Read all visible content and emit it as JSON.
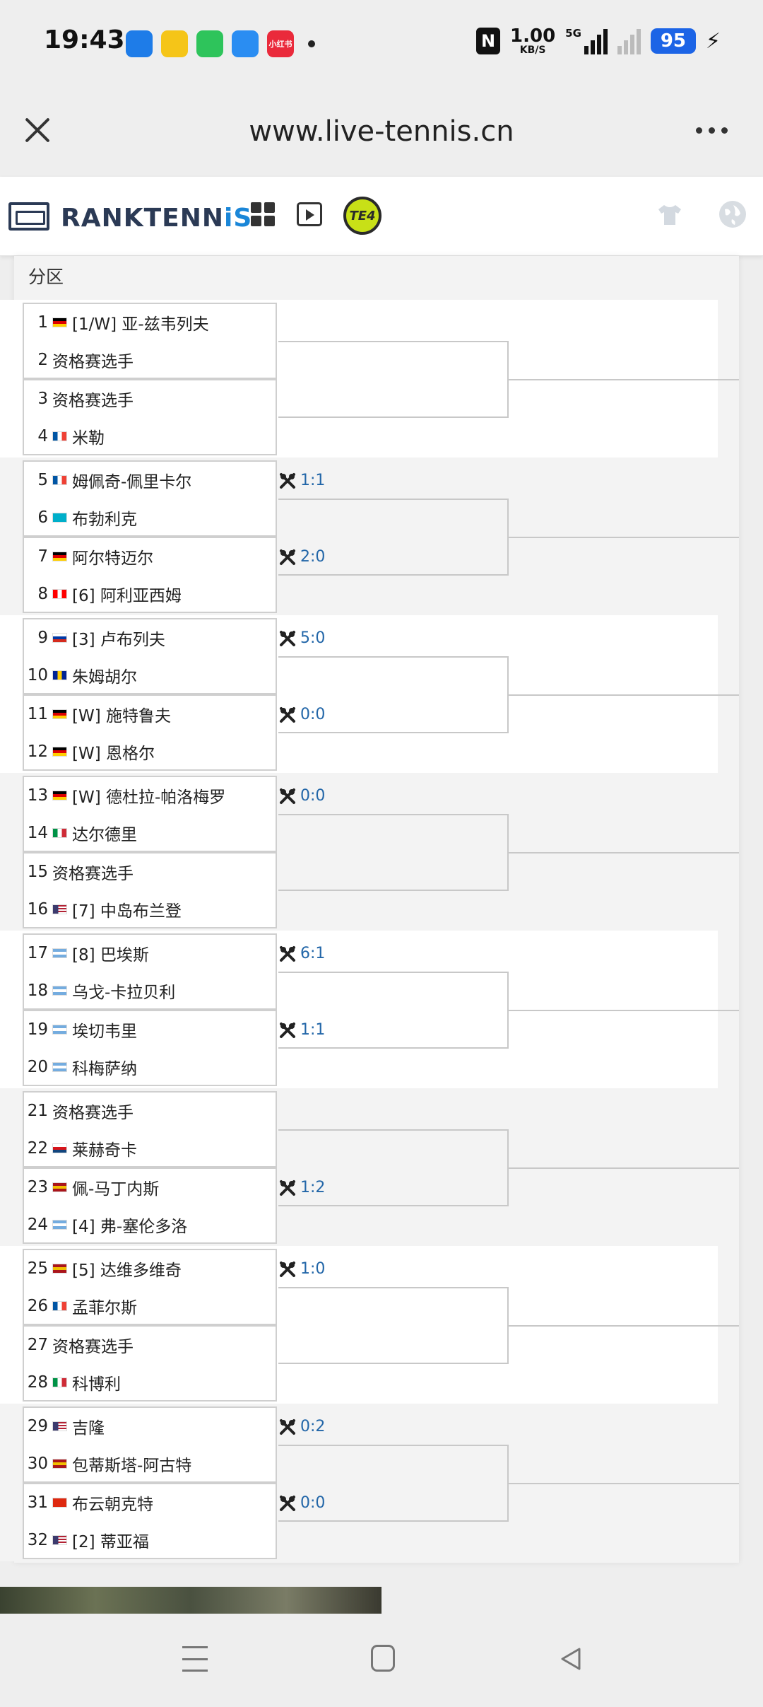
{
  "status_bar": {
    "time": "19:43",
    "apps": [
      {
        "name": "message-app-icon",
        "color": "#1e7ce8",
        "label": ""
      },
      {
        "name": "weibo-app-icon",
        "color": "#f5c518",
        "label": ""
      },
      {
        "name": "green-app-icon",
        "color": "#2ec45b",
        "label": ""
      },
      {
        "name": "feather-app-icon",
        "color": "#2a8df2",
        "label": ""
      },
      {
        "name": "xiaohongshu-app-icon",
        "color": "#ea2a3b",
        "label": "小红书"
      }
    ],
    "nfc": "N",
    "net_speed": "1.00",
    "net_unit": "KB/S",
    "network_type": "5G",
    "battery": "95"
  },
  "browser": {
    "url": "www.live-tennis.cn"
  },
  "site": {
    "logo_primary": "RANKTENN",
    "logo_accent": "iS",
    "badge": "TE4"
  },
  "draw": {
    "section_label": "分区",
    "players": [
      {
        "seed": "1",
        "flag": "de",
        "name": "[1/W] 亚-兹韦列夫"
      },
      {
        "seed": "2",
        "flag": "",
        "name": "资格赛选手"
      },
      {
        "seed": "3",
        "flag": "",
        "name": "资格赛选手"
      },
      {
        "seed": "4",
        "flag": "fr",
        "name": "米勒"
      },
      {
        "seed": "5",
        "flag": "fr",
        "name": "姆佩奇-佩里卡尔"
      },
      {
        "seed": "6",
        "flag": "kz",
        "name": "布勃利克"
      },
      {
        "seed": "7",
        "flag": "de",
        "name": "阿尔特迈尔"
      },
      {
        "seed": "8",
        "flag": "ca",
        "name": "[6] 阿利亚西姆"
      },
      {
        "seed": "9",
        "flag": "ru",
        "name": "[3] 卢布列夫"
      },
      {
        "seed": "10",
        "flag": "ba",
        "name": "朱姆胡尔"
      },
      {
        "seed": "11",
        "flag": "de",
        "name": "[W] 施特鲁夫"
      },
      {
        "seed": "12",
        "flag": "de",
        "name": "[W] 恩格尔"
      },
      {
        "seed": "13",
        "flag": "de",
        "name": "[W] 德杜拉-帕洛梅罗"
      },
      {
        "seed": "14",
        "flag": "it",
        "name": "达尔德里"
      },
      {
        "seed": "15",
        "flag": "",
        "name": "资格赛选手"
      },
      {
        "seed": "16",
        "flag": "us",
        "name": "[7] 中岛布兰登"
      },
      {
        "seed": "17",
        "flag": "ar",
        "name": "[8] 巴埃斯"
      },
      {
        "seed": "18",
        "flag": "ar",
        "name": "乌戈-卡拉贝利"
      },
      {
        "seed": "19",
        "flag": "ar",
        "name": "埃切韦里"
      },
      {
        "seed": "20",
        "flag": "ar",
        "name": "科梅萨纳"
      },
      {
        "seed": "21",
        "flag": "",
        "name": "资格赛选手"
      },
      {
        "seed": "22",
        "flag": "cz",
        "name": "莱赫奇卡"
      },
      {
        "seed": "23",
        "flag": "es",
        "name": "佩-马丁内斯"
      },
      {
        "seed": "24",
        "flag": "ar",
        "name": "[4] 弗-塞伦多洛"
      },
      {
        "seed": "25",
        "flag": "es",
        "name": "[5] 达维多维奇"
      },
      {
        "seed": "26",
        "flag": "fr",
        "name": "孟菲尔斯"
      },
      {
        "seed": "27",
        "flag": "",
        "name": "资格赛选手"
      },
      {
        "seed": "28",
        "flag": "it",
        "name": "科博利"
      },
      {
        "seed": "29",
        "flag": "us",
        "name": "吉隆"
      },
      {
        "seed": "30",
        "flag": "es",
        "name": "包蒂斯塔-阿古特"
      },
      {
        "seed": "31",
        "flag": "cn",
        "name": "布云朝克特"
      },
      {
        "seed": "32",
        "flag": "us",
        "name": "[2] 蒂亚福"
      }
    ],
    "h2h": [
      {
        "match": 2,
        "label": "1:1"
      },
      {
        "match": 3,
        "label": "2:0"
      },
      {
        "match": 4,
        "label": "5:0"
      },
      {
        "match": 5,
        "label": "0:0"
      },
      {
        "match": 6,
        "label": "0:0"
      },
      {
        "match": 8,
        "label": "6:1"
      },
      {
        "match": 9,
        "label": "1:1"
      },
      {
        "match": 11,
        "label": "1:2"
      },
      {
        "match": 12,
        "label": "1:0"
      },
      {
        "match": 14,
        "label": "0:2"
      },
      {
        "match": 15,
        "label": "0:0"
      }
    ],
    "colors": {
      "score_link": "#2266a8",
      "line": "#c8c8c8",
      "band_white": "#ffffff",
      "band_gray": "#f3f3f3"
    }
  },
  "flags": {
    "de": [
      "#000000",
      "#dd0000",
      "#ffce00"
    ],
    "fr": [
      "#0055a4",
      "#ffffff",
      "#ef4135"
    ],
    "it": [
      "#009246",
      "#ffffff",
      "#ce2b37"
    ],
    "ru": [
      "#ffffff",
      "#0039a6",
      "#d52b1e"
    ],
    "ar": [
      "#74acdf",
      "#ffffff",
      "#74acdf"
    ],
    "es": [
      "#aa151b",
      "#f1bf00",
      "#aa151b"
    ],
    "kz": [
      "#00afca",
      "#00afca",
      "#00afca"
    ],
    "ca": [
      "#ff0000",
      "#ffffff",
      "#ff0000"
    ],
    "ba": [
      "#002395",
      "#fecb00",
      "#002395"
    ],
    "cz": [
      "#ffffff",
      "#d7141a",
      "#11457e"
    ],
    "us": [
      "#b22234",
      "#ffffff",
      "#3c3b6e"
    ],
    "cn": [
      "#de2910",
      "#de2910",
      "#de2910"
    ]
  }
}
